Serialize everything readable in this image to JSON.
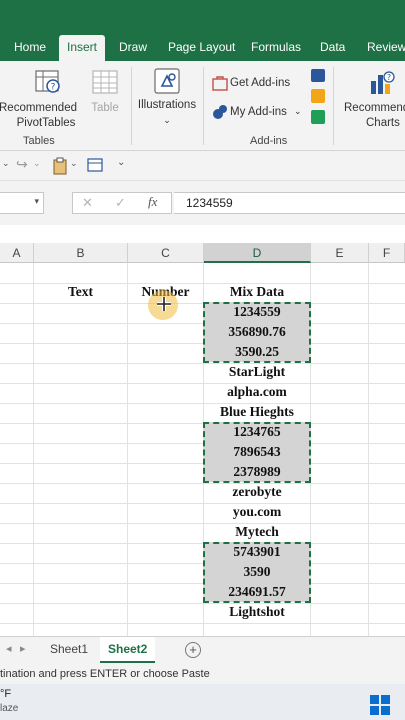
{
  "ribbon_tabs": [
    "Home",
    "Insert",
    "Draw",
    "Page Layout",
    "Formulas",
    "Data",
    "Review"
  ],
  "active_tab": "Insert",
  "ribbon": {
    "recommended_pivot_line1": "Recommended",
    "recommended_pivot_line2": "PivotTables",
    "table_label": "Table",
    "tables_group": "Tables",
    "illustrations_label": "Illustrations",
    "get_addins_label": "Get Add-ins",
    "my_addins_label": "My Add-ins",
    "addins_group": "Add-ins",
    "recommended_charts_line1": "Recommended",
    "recommended_charts_line2": "Charts"
  },
  "formula_bar": {
    "fx_label": "fx",
    "value": "1234559"
  },
  "columns": [
    "A",
    "B",
    "C",
    "D",
    "E",
    "F"
  ],
  "selected_column": "D",
  "headers": {
    "text": "Text",
    "number": "Number",
    "mix_data": "Mix Data"
  },
  "mix_data": [
    {
      "value": "1234559",
      "shaded": true
    },
    {
      "value": "356890.76",
      "shaded": true
    },
    {
      "value": "3590.25",
      "shaded": true
    },
    {
      "value": "StarLight",
      "shaded": false
    },
    {
      "value": "alpha.com",
      "shaded": false
    },
    {
      "value": "Blue Hieghts",
      "shaded": false
    },
    {
      "value": "1234765",
      "shaded": true
    },
    {
      "value": "7896543",
      "shaded": true
    },
    {
      "value": "2378989",
      "shaded": true
    },
    {
      "value": "zerobyte",
      "shaded": false
    },
    {
      "value": "you.com",
      "shaded": false
    },
    {
      "value": "Mytech",
      "shaded": false
    },
    {
      "value": "5743901",
      "shaded": true
    },
    {
      "value": "3590",
      "shaded": true
    },
    {
      "value": "234691.57",
      "shaded": true
    },
    {
      "value": "Lightshot",
      "shaded": false
    }
  ],
  "sheets": [
    "Sheet1",
    "Sheet2"
  ],
  "active_sheet": "Sheet2",
  "status_text": "tination and press ENTER or choose Paste",
  "taskbar": {
    "weather_temp": "°F",
    "weather_desc": "laze"
  },
  "colors": {
    "excel_green": "#1e7145",
    "selection_fill": "#d4d4d4",
    "pointer_highlight": "#f0be3c"
  }
}
